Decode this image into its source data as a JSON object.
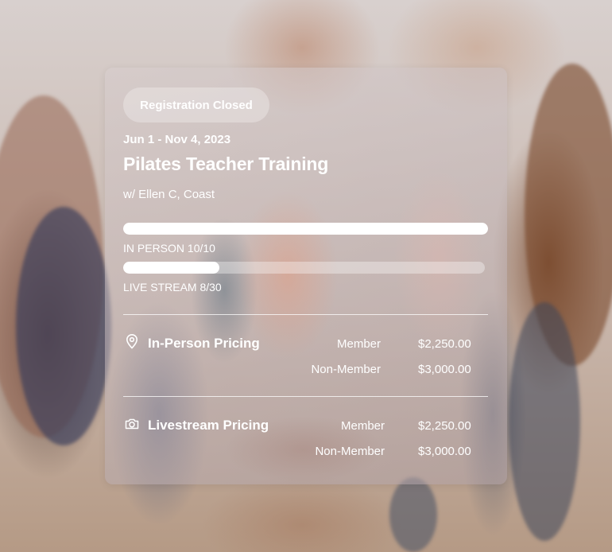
{
  "course": {
    "status_badge": "Registration Closed",
    "dates": "Jun 1 - Nov 4, 2023",
    "title": "Pilates Teacher Training",
    "instructor": "w/ Ellen C, Coast"
  },
  "capacity": [
    {
      "label": "IN PERSON 10/10",
      "filled": 10,
      "total": 10
    },
    {
      "label": "LIVE STREAM 8/30",
      "filled": 8,
      "total": 30
    }
  ],
  "pricing": {
    "in_person": {
      "icon": "location-pin-icon",
      "title": "In-Person Pricing",
      "rows": [
        {
          "label": "Member",
          "price": "$2,250.00"
        },
        {
          "label": "Non-Member",
          "price": "$3,000.00"
        }
      ]
    },
    "livestream": {
      "icon": "camera-icon",
      "title": "Livestream Pricing",
      "rows": [
        {
          "label": "Member",
          "price": "$2,250.00"
        },
        {
          "label": "Non-Member",
          "price": "$3,000.00"
        }
      ]
    }
  },
  "colors": {
    "text": "#ffffff",
    "bar_fill": "#ffffff",
    "bar_track": "rgba(255,255,255,0.35)"
  }
}
